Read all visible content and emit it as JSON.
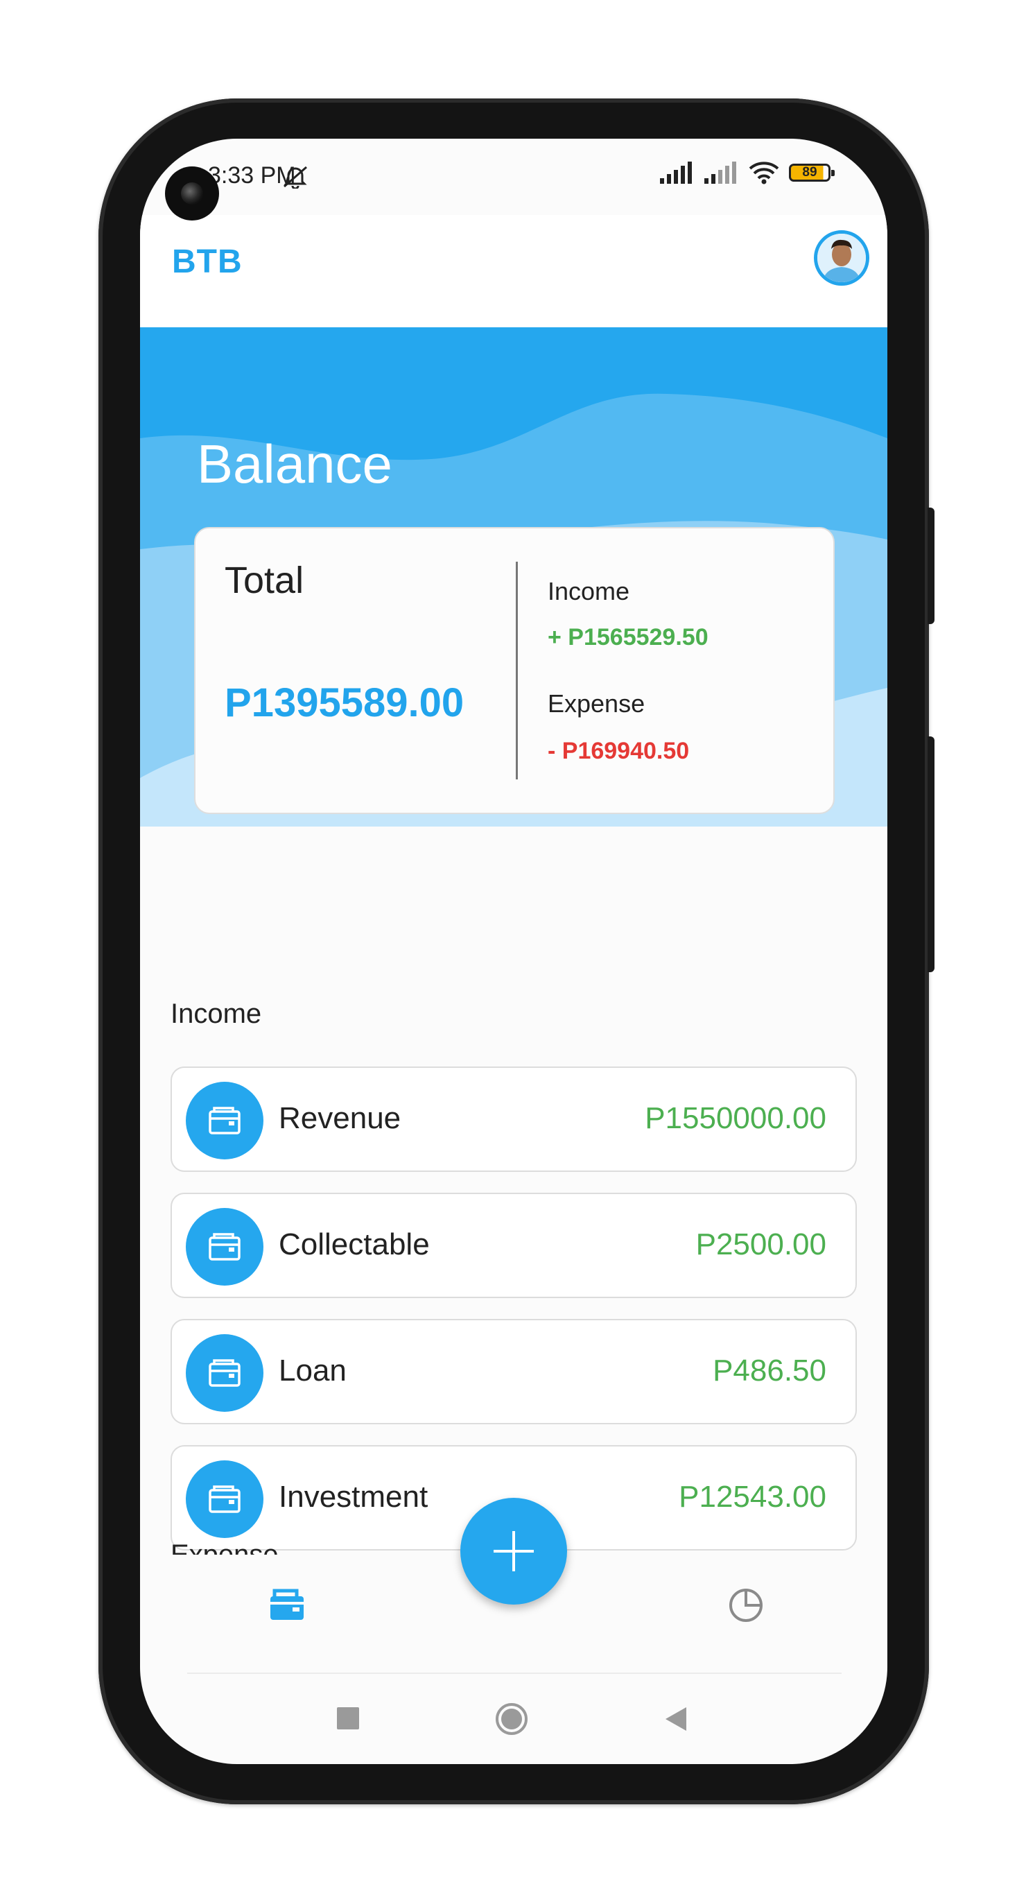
{
  "status_bar": {
    "time": "3:33 PM",
    "battery": "89"
  },
  "app": {
    "title": "BTB"
  },
  "balance": {
    "heading": "Balance",
    "total_label": "Total",
    "total_value": "P1395589.00",
    "income_label": "Income",
    "income_value": "+ P1565529.50",
    "expense_label": "Expense",
    "expense_value": "- P169940.50"
  },
  "income_section": {
    "title": "Income",
    "items": [
      {
        "label": "Revenue",
        "amount": "P1550000.00",
        "icon": "wallet-icon"
      },
      {
        "label": "Collectable",
        "amount": "P2500.00",
        "icon": "wallet-icon"
      },
      {
        "label": "Loan",
        "amount": "P486.50",
        "icon": "wallet-icon"
      },
      {
        "label": "Investment",
        "amount": "P12543.00",
        "icon": "wallet-icon"
      }
    ]
  },
  "expense_section": {
    "title": "Expense"
  },
  "bottom_nav": {
    "items": [
      "wallet-icon",
      "add-icon",
      "pie-chart-icon"
    ]
  },
  "system_nav": {
    "buttons": [
      "recents-icon",
      "home-icon",
      "back-icon"
    ]
  },
  "colors": {
    "accent": "#22a4ec",
    "income": "#4caf50",
    "expense": "#e53935"
  }
}
